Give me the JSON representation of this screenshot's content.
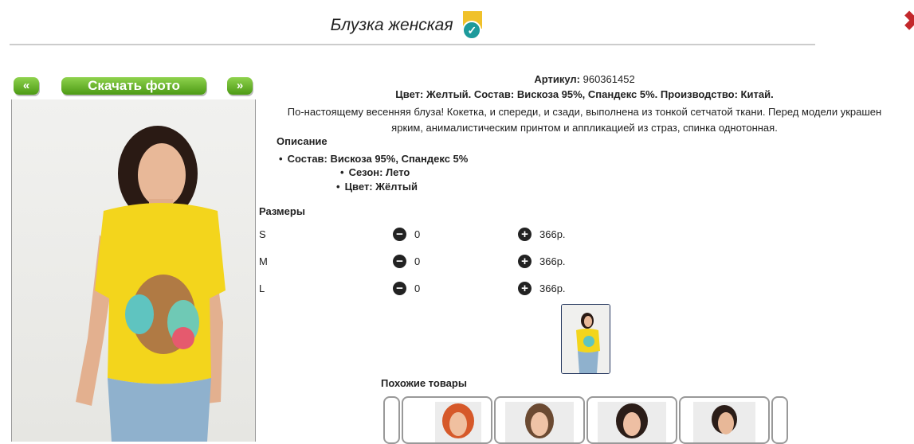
{
  "header": {
    "title": "Блузка женская"
  },
  "nav": {
    "prev_label": "«",
    "download_label": "Скачать фото",
    "next_label": "»"
  },
  "product": {
    "sku_label": "Артикул:",
    "sku_value": "960361452",
    "summary": "Цвет: Желтый. Состав: Вискоза 95%, Спандекс 5%. Производство: Китай.",
    "paragraph_line1": "По-настоящему весенняя блуза! Кокетка, и спереди, и сзади, выполнена из тонкой сетчатой ткани. Перед модели украшен",
    "paragraph_line2": "ярким, анималистическим принтом и аппликацией из страз, спинка однотонная.",
    "description_heading": "Описание",
    "bullets": [
      "Состав: Вискоза 95%, Спандекс 5%",
      "Сезон: Лето",
      "Цвет: Жёлтый"
    ]
  },
  "sizes": {
    "heading": "Размеры",
    "rows": [
      {
        "size": "S",
        "qty": "0",
        "price": "366р."
      },
      {
        "size": "M",
        "qty": "0",
        "price": "366р."
      },
      {
        "size": "L",
        "qty": "0",
        "price": "366р."
      }
    ]
  },
  "similar": {
    "heading": "Похожие товары"
  },
  "colors": {
    "accent_green": "#5aab1e",
    "shirt_yellow": "#f3d51c",
    "close_red": "#c3272b"
  }
}
